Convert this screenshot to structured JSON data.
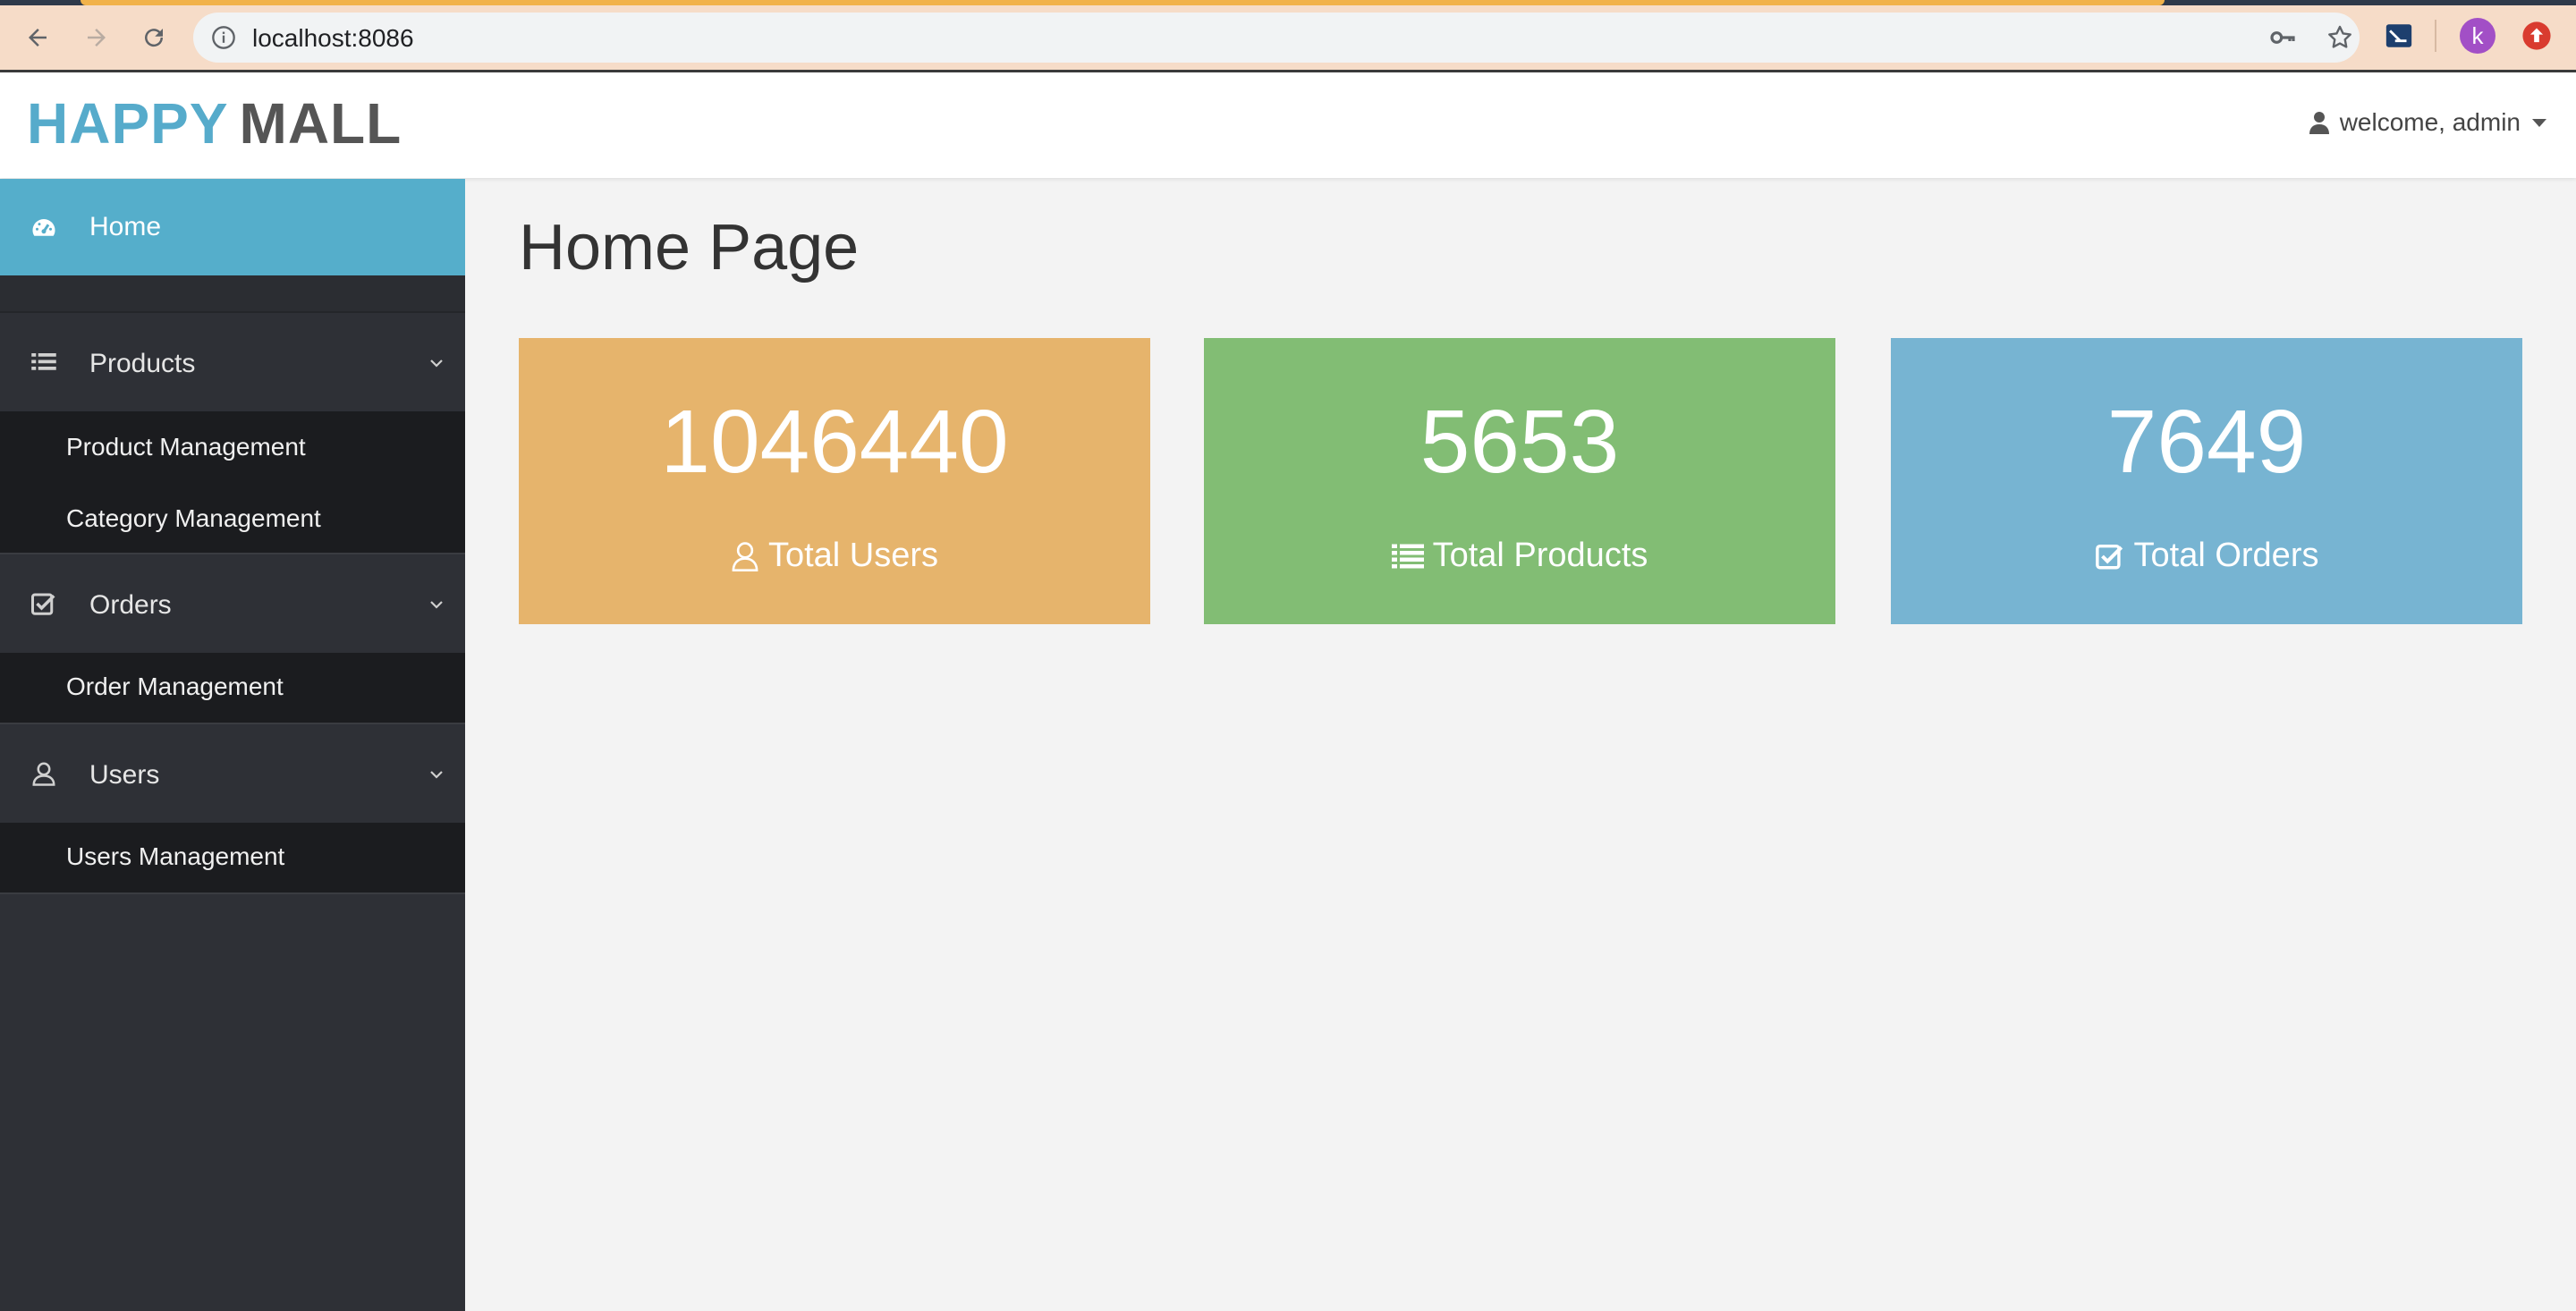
{
  "browser": {
    "url": "localhost:8086",
    "avatar_initial": "k"
  },
  "header": {
    "brand_part1": "HAPPY",
    "brand_part2": "MALL",
    "user_greeting": "welcome, admin"
  },
  "sidebar": {
    "home": "Home",
    "sections": [
      {
        "label": "Products",
        "icon": "list-icon",
        "items": [
          "Product Management",
          "Category Management"
        ]
      },
      {
        "label": "Orders",
        "icon": "check-square-icon",
        "items": [
          "Order Management"
        ]
      },
      {
        "label": "Users",
        "icon": "user-icon",
        "items": [
          "Users Management"
        ]
      }
    ]
  },
  "main": {
    "title": "Home Page",
    "cards": [
      {
        "value": "1046440",
        "label": "Total Users",
        "icon": "user-icon",
        "color": "#e6b46c"
      },
      {
        "value": "5653",
        "label": "Total Products",
        "icon": "list-icon",
        "color": "#82bd74"
      },
      {
        "value": "7649",
        "label": "Total Orders",
        "icon": "check-square-icon",
        "color": "#77b4d2"
      }
    ]
  },
  "colors": {
    "sidebar_bg": "#2e3036",
    "sidebar_active": "#55aecb",
    "submenu_bg": "#1b1c1f",
    "brand_blue": "#56abcb",
    "brand_gray": "#555555"
  }
}
